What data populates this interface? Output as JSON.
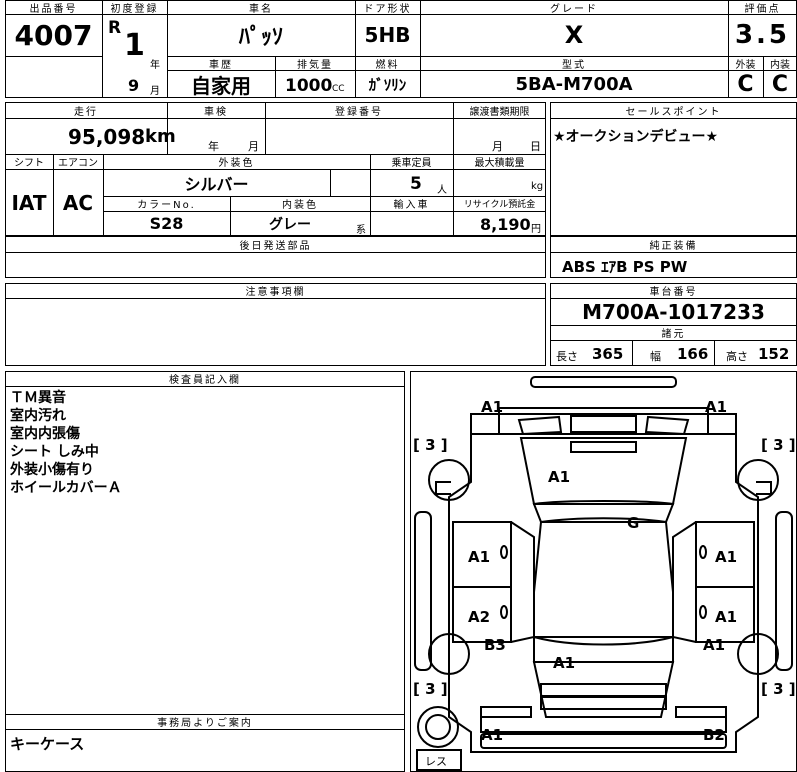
{
  "headers": {
    "lot": "出品番号",
    "first_reg": "初度登録",
    "car_name": "車名",
    "door": "ドア形状",
    "grade": "グレード",
    "score": "評価点",
    "history": "車歴",
    "displacement": "排気量",
    "fuel": "燃料",
    "model": "型式",
    "exterior": "外装",
    "interior": "内装",
    "mileage": "走行",
    "inspection": "車検",
    "reg_no": "登録番号",
    "transfer": "譲渡書類期限",
    "sales_point": "セールスポイント",
    "shift": "シフト",
    "aircon": "エアコン",
    "ext_color": "外装色",
    "capacity": "乗車定員",
    "max_load": "最大積載量",
    "color_no": "カラーNo.",
    "int_color": "内装色",
    "import": "輸入車",
    "recycle": "リサイクル預託金",
    "later_parts": "後日発送部品",
    "equipment": "純正装備",
    "notice": "注意事項欄",
    "chassis_no": "車台番号",
    "dims": "諸元",
    "inspector": "検査員記入欄",
    "office": "事務局よりご案内"
  },
  "lot_number": "4007",
  "era": "R",
  "year": "1",
  "year_unit": "年",
  "month": "9",
  "month_unit": "月",
  "car_name": "ﾊﾟｯｿ",
  "door_type": "5HB",
  "grade": "X",
  "score": "3.5",
  "history": "自家用",
  "displacement": "1000",
  "displacement_unit": "CC",
  "fuel": "ｶﾞｿﾘﾝ",
  "model_code": "5BA-M700A",
  "exterior_grade": "C",
  "interior_grade": "C",
  "mileage": "95,098",
  "mileage_unit": "km",
  "inspection_year_unit": "年",
  "inspection_month_unit": "月",
  "transfer_month_unit": "月",
  "transfer_day_unit": "日",
  "sales_point": "★オークションデビュー★",
  "shift": "IAT",
  "aircon": "AC",
  "ext_color": "シルバー",
  "capacity": "5",
  "capacity_unit": "人",
  "max_load_unit": "kg",
  "color_no": "S28",
  "int_color": "グレー",
  "int_color_unit": "系",
  "recycle": "8,190",
  "recycle_unit": "円",
  "equipment": "ABS ｴｱB PS PW",
  "chassis_no": "M700A-1017233",
  "dims": {
    "length_label": "長さ",
    "length": "365",
    "width_label": "幅",
    "width": "166",
    "height_label": "高さ",
    "height": "152"
  },
  "inspector_notes": [
    "ＴＭ異音",
    "室内汚れ",
    "室内内張傷",
    "シート しみ中",
    "外装小傷有り",
    "ホイールカバーＡ"
  ],
  "office_notes": "キーケース",
  "diagram": {
    "bracket": "[ 3 ]",
    "spare_label": "レス",
    "marks": [
      "A1",
      "A1",
      "A1",
      "G",
      "A1",
      "A1",
      "A2",
      "A1",
      "B3",
      "A1",
      "A1",
      "A1",
      "B2"
    ]
  }
}
